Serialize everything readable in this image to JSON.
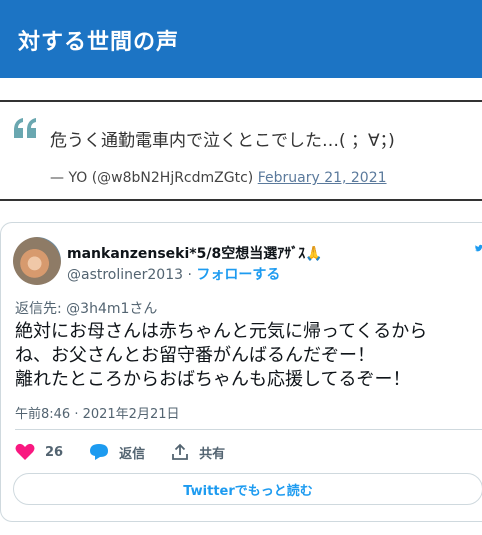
{
  "section": {
    "title": "対する世間の声"
  },
  "quote": {
    "text": "危うく通勤電車内で泣くとこでした…( ；∀；)",
    "author": "— YO (@w8bN2HjRcdmZGtc)",
    "date": "February 21, 2021"
  },
  "tweet": {
    "display_name": "mankanzenseki*5/8空想当選ｱｻﾞｽ🙏",
    "handle": "@astroliner2013",
    "separator": " · ",
    "follow_label": "フォローする",
    "reply_to": "返信先: @3h4m1さん",
    "text_lines": [
      "絶対にお母さんは赤ちゃんと元気に帰ってくるから",
      "ね、お父さんとお留守番がんばるんだぞー！",
      "離れたところからおばちゃんも応援してるぞー！"
    ],
    "timestamp": "午前8:46 · 2021年2月21日",
    "like_count": "26",
    "reply_label": "返信",
    "share_label": "共有",
    "read_more_label": "Twitterでもっと読む"
  },
  "colors": {
    "header_bg": "#1c74c4",
    "quote_icon": "#6aa7b0",
    "like_pink": "#f91880",
    "reply_blue": "#1d9bf0",
    "link_blue": "#1d9bf0"
  },
  "icons": {
    "quote": "quote-mark-icon",
    "like": "heart-icon",
    "reply": "speech-bubble-icon",
    "share": "share-arrow-icon",
    "twitter": "twitter-bird-icon"
  }
}
